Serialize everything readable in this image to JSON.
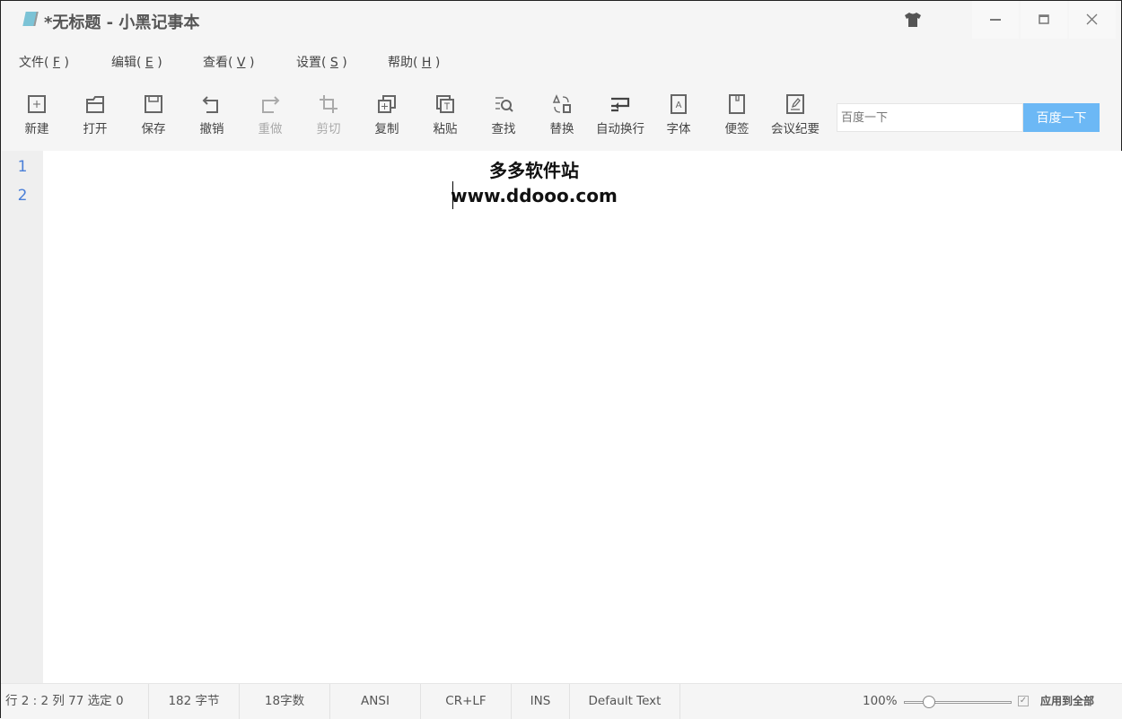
{
  "window": {
    "title": "*无标题 - 小黑记事本"
  },
  "menu": [
    {
      "label": "文件(",
      "key": "F",
      "end": ")"
    },
    {
      "label": "编辑(",
      "key": "E",
      "end": ")"
    },
    {
      "label": "查看(",
      "key": "V",
      "end": ")"
    },
    {
      "label": "设置(",
      "key": "S",
      "end": ")"
    },
    {
      "label": "帮助(",
      "key": "H",
      "end": ")"
    }
  ],
  "toolbar": [
    {
      "label": "新建",
      "icon": "new-file-icon"
    },
    {
      "label": "打开",
      "icon": "folder-icon"
    },
    {
      "label": "保存",
      "icon": "save-icon"
    },
    {
      "label": "撤销",
      "icon": "undo-icon"
    },
    {
      "label": "重做",
      "icon": "redo-icon",
      "disabled": true
    },
    {
      "label": "剪切",
      "icon": "crop-cut-icon",
      "disabled": true
    },
    {
      "label": "复制",
      "icon": "copy-icon"
    },
    {
      "label": "粘贴",
      "icon": "paste-icon"
    },
    {
      "label": "查找",
      "icon": "find-icon"
    },
    {
      "label": "替换",
      "icon": "replace-icon"
    },
    {
      "label": "自动换行",
      "icon": "wrap-icon"
    },
    {
      "label": "字体",
      "icon": "font-icon"
    },
    {
      "label": "便签",
      "icon": "note-icon"
    },
    {
      "label": "会议纪要",
      "icon": "minutes-icon"
    }
  ],
  "search": {
    "placeholder": "百度一下",
    "button": "百度一下",
    "accent": "#6cb8f5"
  },
  "editor": {
    "line_numbers": [
      "1",
      "2"
    ],
    "lines": [
      "多多软件站",
      "www.ddooo.com"
    ]
  },
  "status": {
    "position": "行 2 : 2   列 77   选定 0",
    "bytes": "182 字节",
    "chars": "18字数",
    "encoding": "ANSI",
    "eol": "CR+LF",
    "mode": "INS",
    "syntax": "Default Text",
    "zoom": "100%",
    "zoom_fraction": 0.2,
    "apply_all": "应用到全部",
    "apply_all_checked": true
  }
}
